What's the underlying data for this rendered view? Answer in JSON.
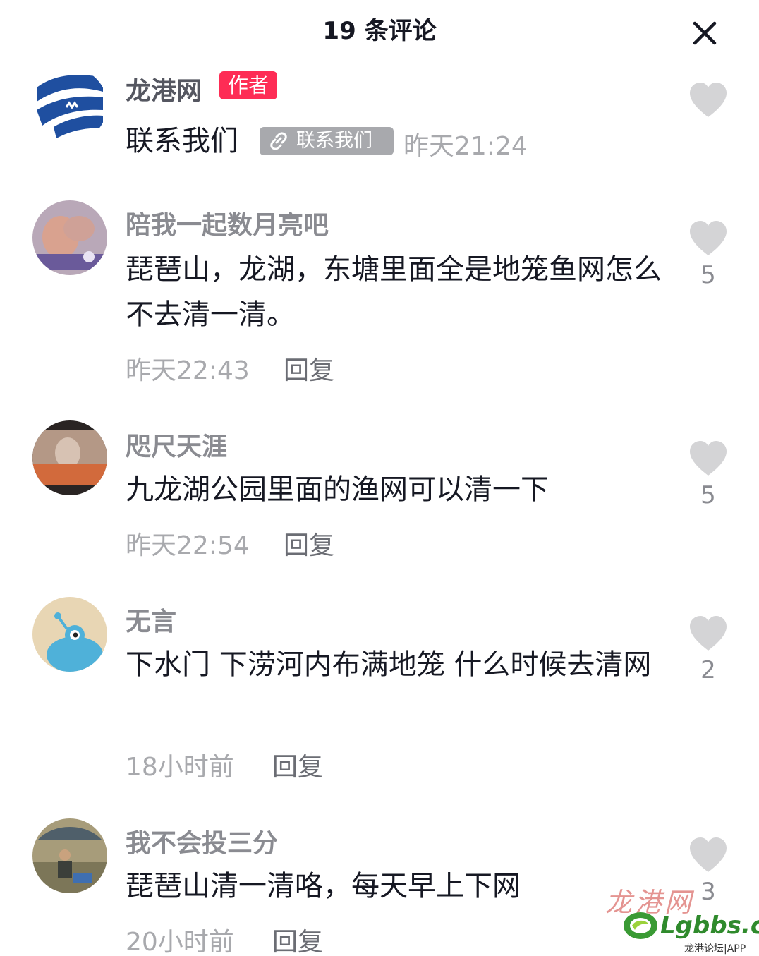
{
  "header": {
    "title": "19 条评论",
    "close_icon": "close-icon"
  },
  "comments": [
    {
      "username": "龙港网",
      "badge": "作者",
      "text": "联系我们",
      "link_chip": "联系我们",
      "time": "昨天21:24",
      "likes": ""
    },
    {
      "username": "陪我一起数月亮吧",
      "text": "琵琶山，龙湖，东塘里面全是地笼鱼网怎么不去清一清。",
      "time": "昨天22:43",
      "reply": "回复",
      "likes": "5"
    },
    {
      "username": "咫尺天涯",
      "text": "九龙湖公园里面的渔网可以清一下",
      "time": "昨天22:54",
      "reply": "回复",
      "likes": "5"
    },
    {
      "username": "无言",
      "text": "下水门 下涝河内布满地笼 什么时候去清网",
      "time": "18小时前",
      "reply": "回复",
      "likes": "2"
    },
    {
      "username": "我不会投三分",
      "text": "琵琶山清一清咯，每天早上下网",
      "time": "20小时前",
      "reply": "回复",
      "likes": "3"
    }
  ],
  "watermark": {
    "cn": "龙港网",
    "domain": "Lgbbs.cn",
    "sub": "龙港论坛|APP"
  },
  "colors": {
    "badge": "#fe2c55",
    "like_icon": "#d4d4d6",
    "meta": "#a8a9ad"
  }
}
